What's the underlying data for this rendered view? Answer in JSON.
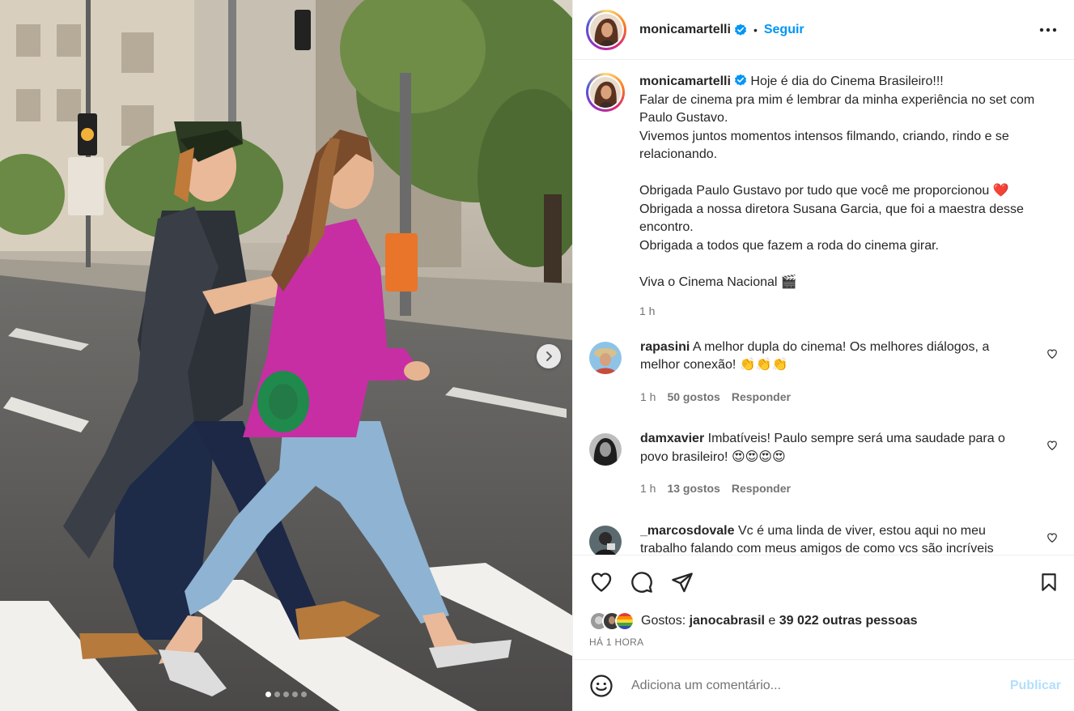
{
  "post": {
    "username": "monicamartelli",
    "follow_label": "Seguir",
    "separator": "•",
    "more_icon": "more-horizontal-icon"
  },
  "media": {
    "next_icon": "chevron-right-icon",
    "slide_count": 5,
    "active_slide": 1
  },
  "caption": {
    "username": "monicamartelli",
    "text": " Hoje é dia do Cinema Brasileiro!!!\nFalar de cinema pra mim é lembrar da minha experiência no set com Paulo Gustavo.\nVivemos juntos momentos intensos filmando, criando, rindo e se relacionando.\n\nObrigada Paulo Gustavo por tudo que você me proporcionou ❤️\nObrigada a nossa diretora Susana Garcia, que foi a maestra desse encontro.\nObrigada a todos que fazem a roda do cinema girar.\n\nViva o Cinema Nacional 🎬",
    "time": "1 h"
  },
  "comments": [
    {
      "username": "rapasini",
      "text": " A melhor dupla do cinema! Os melhores diálogos, a melhor conexão! 👏👏👏",
      "time": "1 h",
      "likes": "50 gostos",
      "reply": "Responder"
    },
    {
      "username": "damxavier",
      "text": " Imbatíveis! Paulo sempre será uma saudade para o povo brasileiro! 😍😍😍😍",
      "time": "1 h",
      "likes": "13 gostos",
      "reply": "Responder"
    },
    {
      "username": "_marcosdovale",
      "text": " Vc é uma linda de viver, estou aqui no meu trabalho falando com meus amigos de como vcs são incríveis"
    }
  ],
  "actions": {
    "like_icon": "heart-icon",
    "comment_icon": "comment-icon",
    "share_icon": "share-icon",
    "save_icon": "bookmark-icon"
  },
  "likes": {
    "prefix": "Gostos: ",
    "first_user": "janocabrasil",
    "connector": " e ",
    "others": "39 022 outras pessoas"
  },
  "post_time": "HÁ 1 HORA",
  "add_comment": {
    "emoji_icon": "emoji-icon",
    "placeholder": "Adiciona um comentário...",
    "publish_label": "Publicar"
  },
  "colors": {
    "accent": "#0095f6",
    "publish_disabled": "#b2dffc",
    "muted_text": "#737373",
    "border": "#efefef"
  }
}
